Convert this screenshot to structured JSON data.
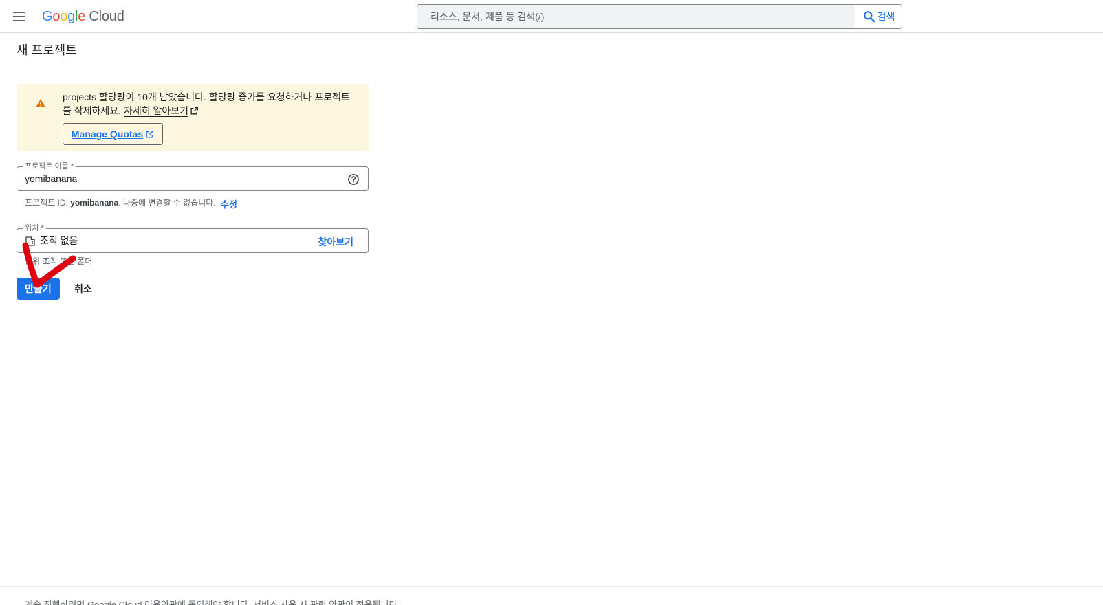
{
  "topbar": {
    "menu_icon": "hamburger-menu-icon",
    "logo": {
      "letters": [
        {
          "ch": "G",
          "color": "#4285F4"
        },
        {
          "ch": "o",
          "color": "#EA4335"
        },
        {
          "ch": "o",
          "color": "#FBBC05"
        },
        {
          "ch": "g",
          "color": "#4285F4"
        },
        {
          "ch": "l",
          "color": "#34A853"
        },
        {
          "ch": "e",
          "color": "#EA4335"
        }
      ],
      "word": "Google",
      "product": "Cloud"
    },
    "search": {
      "placeholder": "리소스, 문서, 제품 등 검색(/)",
      "button_label": "검색",
      "button_icon": "search-icon"
    }
  },
  "page": {
    "title": "새 프로젝트"
  },
  "quota_warning": {
    "icon": "warning-icon",
    "message": "projects 할당량이 10개 남았습니다. 할당량 증가를 요청하거나 프로젝트를 삭제하세요.",
    "learn_more": "자세히 알아보기",
    "manage_quotas_label": "Manage Quotas",
    "accent_color": "#E37400",
    "background_color": "#FEF7E0"
  },
  "form": {
    "project_name": {
      "label": "프로젝트 이름 *",
      "value": "yomibanana",
      "help_icon": "help-circle-icon"
    },
    "project_id_hint": {
      "prefix": "프로젝트 ID: ",
      "id": "yomibanana",
      "suffix": ". 나중에 변경할 수 없습니다.",
      "edit_label": "수정"
    },
    "location": {
      "label": "위치 *",
      "value": "조직 없음",
      "icon": "building-icon",
      "browse_label": "찾아보기",
      "hint": "상위 조직 또는 폴더"
    },
    "create_label": "만들기",
    "cancel_label": "취소"
  },
  "annotation": {
    "checkmark_color": "#E0000F"
  },
  "footer": {
    "text": "계속 진행하려면 Google Cloud 이용약관에 동의해야 합니다. 서비스 사용 시 관련 약관이 적용됩니다."
  },
  "colors": {
    "primary": "#1A73E8",
    "text": "#202124",
    "secondary_text": "#5F6368"
  }
}
